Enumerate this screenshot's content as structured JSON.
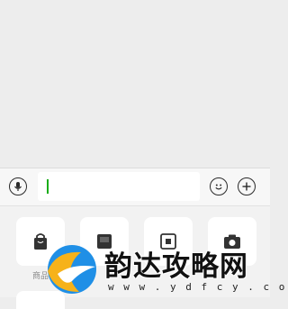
{
  "input_bar": {
    "voice_icon": "microphone-icon",
    "text_value": "",
    "emoji_icon": "smiley-icon",
    "more_icon": "plus-icon"
  },
  "panel": {
    "tiles": [
      {
        "icon": "shopping-bag-icon",
        "label": "商品"
      },
      {
        "icon": "image-icon",
        "label": ""
      },
      {
        "icon": "photo-frame-icon",
        "label": ""
      },
      {
        "icon": "camera-icon",
        "label": ""
      }
    ]
  },
  "watermark": {
    "text": "韵达攻略网",
    "url": "w w w . y d f c y . c o m",
    "logo": "yunda-logo",
    "colors": {
      "logo_blue": "#1f8fe6",
      "logo_yellow": "#f6b21a"
    }
  },
  "colors": {
    "caret": "#1aad19",
    "background": "#ededed"
  }
}
